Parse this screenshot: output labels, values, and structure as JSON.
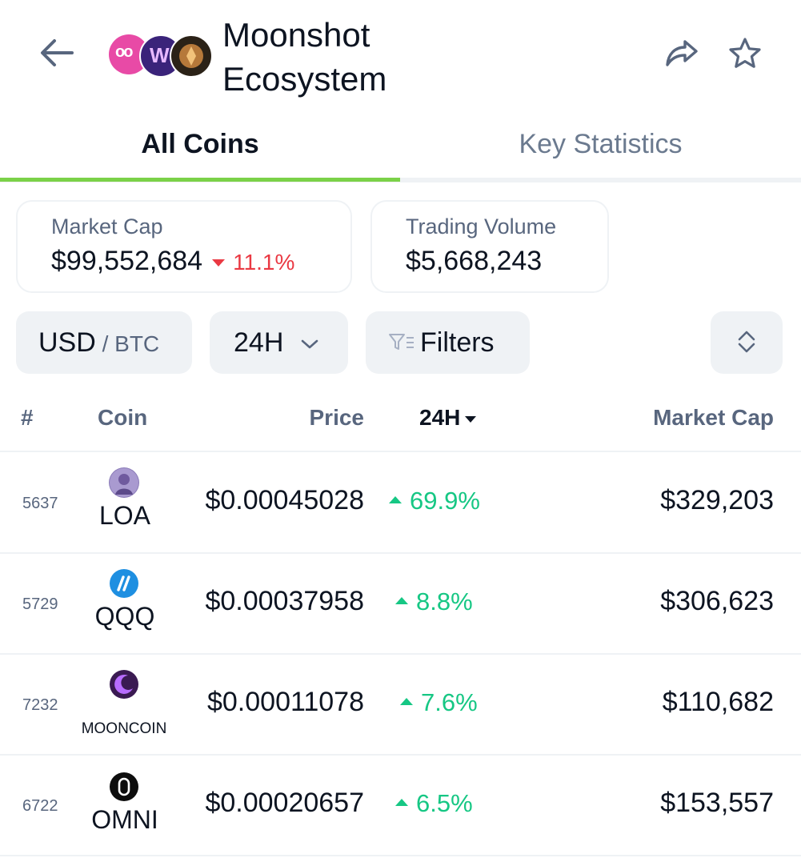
{
  "header": {
    "title_line1": "Moonshot",
    "title_line2": "Ecosystem",
    "logo_text_1": "oo",
    "logo_text_2": "W",
    "icons": [
      "back-arrow-icon",
      "ecosystem-logos",
      "share-icon",
      "star-icon"
    ]
  },
  "tabs": [
    {
      "label": "All Coins",
      "active": true
    },
    {
      "label": "Key Statistics",
      "active": false
    }
  ],
  "stats": {
    "market_cap_label": "Market Cap",
    "market_cap_value": "$99,552,684",
    "market_cap_change": "11.1%",
    "trading_volume_label": "Trading Volume",
    "trading_volume_value": "$5,668,243"
  },
  "controls": {
    "currency_primary": "USD",
    "currency_separator": " / ",
    "currency_secondary": "BTC",
    "timeframe": "24H",
    "filters_label": "Filters"
  },
  "table": {
    "headers": {
      "rank": "#",
      "coin": "Coin",
      "price": "Price",
      "change": "24H",
      "market_cap": "Market Cap"
    },
    "rows": [
      {
        "rank": "5637",
        "symbol": "LOA",
        "price": "$0.00045028",
        "change": "69.9%",
        "market_cap": "$329,203"
      },
      {
        "rank": "5729",
        "symbol": "QQQ",
        "price": "$0.00037958",
        "change": "8.8%",
        "market_cap": "$306,623"
      },
      {
        "rank": "7232",
        "symbol": "MOONCOIN",
        "price": "$0.00011078",
        "change": "7.6%",
        "market_cap": "$110,682"
      },
      {
        "rank": "6722",
        "symbol": "OMNI",
        "price": "$0.00020657",
        "change": "6.5%",
        "market_cap": "$153,557"
      }
    ]
  },
  "colors": {
    "accent_tab": "#7bd148",
    "positive": "#16c784",
    "negative": "#ea3943",
    "text_primary": "#0d1421",
    "text_secondary": "#58667e",
    "button_bg": "#eff2f5"
  }
}
